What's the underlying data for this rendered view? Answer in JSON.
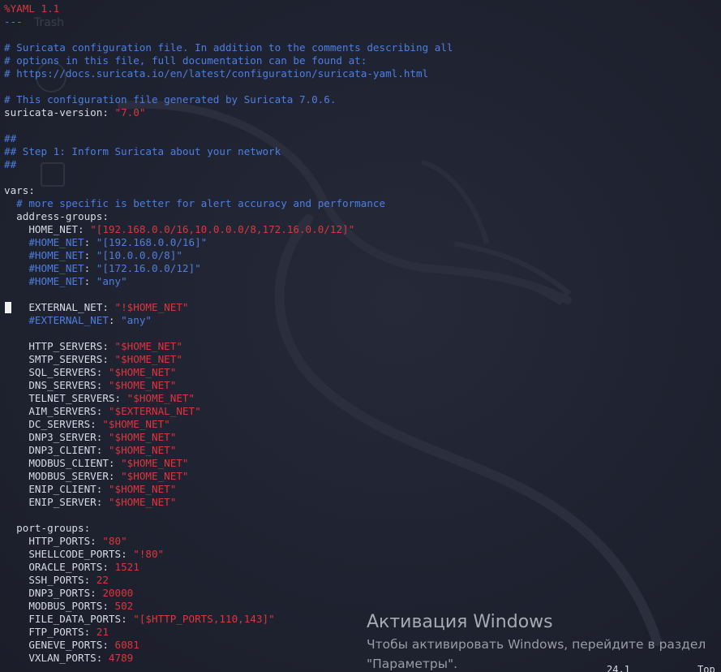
{
  "desktop": {
    "trash_label": "Trash"
  },
  "editor": {
    "lines": [
      [
        [
          "dir",
          "%YAML 1.1"
        ]
      ],
      [
        [
          "sep",
          "---"
        ]
      ],
      [],
      [
        [
          "c",
          "# Suricata configuration file. In addition to the comments describing all"
        ]
      ],
      [
        [
          "c",
          "# options in this file, full documentation can be found at:"
        ]
      ],
      [
        [
          "c",
          "# https://docs.suricata.io/en/latest/configuration/suricata-yaml.html"
        ]
      ],
      [],
      [
        [
          "c",
          "# This configuration file generated by Suricata 7.0.6."
        ]
      ],
      [
        [
          "k",
          "suricata-version"
        ],
        [
          "p",
          ": "
        ],
        [
          "s",
          "\"7.0\""
        ]
      ],
      [],
      [
        [
          "c",
          "##"
        ]
      ],
      [
        [
          "c",
          "## Step 1: Inform Suricata about your network"
        ]
      ],
      [
        [
          "c",
          "##"
        ]
      ],
      [],
      [
        [
          "k",
          "vars"
        ],
        [
          "p",
          ":"
        ]
      ],
      [
        [
          "p",
          "  "
        ],
        [
          "c",
          "# more specific is better for alert accuracy and performance"
        ]
      ],
      [
        [
          "p",
          "  "
        ],
        [
          "k",
          "address-groups"
        ],
        [
          "p",
          ":"
        ]
      ],
      [
        [
          "p",
          "    "
        ],
        [
          "k",
          "HOME_NET"
        ],
        [
          "p",
          ": "
        ],
        [
          "s",
          "\"[192.168.0.0/16,10.0.0.0/8,172.16.0.0/12]\""
        ]
      ],
      [
        [
          "p",
          "    "
        ],
        [
          "c",
          "#HOME_NET"
        ],
        [
          "p",
          ": "
        ],
        [
          "c",
          "\"[192.168.0.0/16]\""
        ]
      ],
      [
        [
          "p",
          "    "
        ],
        [
          "c",
          "#HOME_NET"
        ],
        [
          "p",
          ": "
        ],
        [
          "c",
          "\"[10.0.0.0/8]\""
        ]
      ],
      [
        [
          "p",
          "    "
        ],
        [
          "c",
          "#HOME_NET"
        ],
        [
          "p",
          ": "
        ],
        [
          "c",
          "\"[172.16.0.0/12]\""
        ]
      ],
      [
        [
          "p",
          "    "
        ],
        [
          "c",
          "#HOME_NET"
        ],
        [
          "p",
          ": "
        ],
        [
          "c",
          "\"any\""
        ]
      ],
      [],
      [
        [
          "p",
          "    "
        ],
        [
          "k",
          "EXTERNAL_NET"
        ],
        [
          "p",
          ": "
        ],
        [
          "s",
          "\"!$HOME_NET\""
        ]
      ],
      [
        [
          "p",
          "    "
        ],
        [
          "c",
          "#EXTERNAL_NET"
        ],
        [
          "p",
          ": "
        ],
        [
          "c",
          "\"any\""
        ]
      ],
      [],
      [
        [
          "p",
          "    "
        ],
        [
          "k",
          "HTTP_SERVERS"
        ],
        [
          "p",
          ": "
        ],
        [
          "s",
          "\"$HOME_NET\""
        ]
      ],
      [
        [
          "p",
          "    "
        ],
        [
          "k",
          "SMTP_SERVERS"
        ],
        [
          "p",
          ": "
        ],
        [
          "s",
          "\"$HOME_NET\""
        ]
      ],
      [
        [
          "p",
          "    "
        ],
        [
          "k",
          "SQL_SERVERS"
        ],
        [
          "p",
          ": "
        ],
        [
          "s",
          "\"$HOME_NET\""
        ]
      ],
      [
        [
          "p",
          "    "
        ],
        [
          "k",
          "DNS_SERVERS"
        ],
        [
          "p",
          ": "
        ],
        [
          "s",
          "\"$HOME_NET\""
        ]
      ],
      [
        [
          "p",
          "    "
        ],
        [
          "k",
          "TELNET_SERVERS"
        ],
        [
          "p",
          ": "
        ],
        [
          "s",
          "\"$HOME_NET\""
        ]
      ],
      [
        [
          "p",
          "    "
        ],
        [
          "k",
          "AIM_SERVERS"
        ],
        [
          "p",
          ": "
        ],
        [
          "s",
          "\"$EXTERNAL_NET\""
        ]
      ],
      [
        [
          "p",
          "    "
        ],
        [
          "k",
          "DC_SERVERS"
        ],
        [
          "p",
          ": "
        ],
        [
          "s",
          "\"$HOME_NET\""
        ]
      ],
      [
        [
          "p",
          "    "
        ],
        [
          "k",
          "DNP3_SERVER"
        ],
        [
          "p",
          ": "
        ],
        [
          "s",
          "\"$HOME_NET\""
        ]
      ],
      [
        [
          "p",
          "    "
        ],
        [
          "k",
          "DNP3_CLIENT"
        ],
        [
          "p",
          ": "
        ],
        [
          "s",
          "\"$HOME_NET\""
        ]
      ],
      [
        [
          "p",
          "    "
        ],
        [
          "k",
          "MODBUS_CLIENT"
        ],
        [
          "p",
          ": "
        ],
        [
          "s",
          "\"$HOME_NET\""
        ]
      ],
      [
        [
          "p",
          "    "
        ],
        [
          "k",
          "MODBUS_SERVER"
        ],
        [
          "p",
          ": "
        ],
        [
          "s",
          "\"$HOME_NET\""
        ]
      ],
      [
        [
          "p",
          "    "
        ],
        [
          "k",
          "ENIP_CLIENT"
        ],
        [
          "p",
          ": "
        ],
        [
          "s",
          "\"$HOME_NET\""
        ]
      ],
      [
        [
          "p",
          "    "
        ],
        [
          "k",
          "ENIP_SERVER"
        ],
        [
          "p",
          ": "
        ],
        [
          "s",
          "\"$HOME_NET\""
        ]
      ],
      [],
      [
        [
          "p",
          "  "
        ],
        [
          "k",
          "port-groups"
        ],
        [
          "p",
          ":"
        ]
      ],
      [
        [
          "p",
          "    "
        ],
        [
          "k",
          "HTTP_PORTS"
        ],
        [
          "p",
          ": "
        ],
        [
          "s",
          "\"80\""
        ]
      ],
      [
        [
          "p",
          "    "
        ],
        [
          "k",
          "SHELLCODE_PORTS"
        ],
        [
          "p",
          ": "
        ],
        [
          "s",
          "\"!80\""
        ]
      ],
      [
        [
          "p",
          "    "
        ],
        [
          "k",
          "ORACLE_PORTS"
        ],
        [
          "p",
          ": "
        ],
        [
          "n",
          "1521"
        ]
      ],
      [
        [
          "p",
          "    "
        ],
        [
          "k",
          "SSH_PORTS"
        ],
        [
          "p",
          ": "
        ],
        [
          "n",
          "22"
        ]
      ],
      [
        [
          "p",
          "    "
        ],
        [
          "k",
          "DNP3_PORTS"
        ],
        [
          "p",
          ": "
        ],
        [
          "n",
          "20000"
        ]
      ],
      [
        [
          "p",
          "    "
        ],
        [
          "k",
          "MODBUS_PORTS"
        ],
        [
          "p",
          ": "
        ],
        [
          "n",
          "502"
        ]
      ],
      [
        [
          "p",
          "    "
        ],
        [
          "k",
          "FILE_DATA_PORTS"
        ],
        [
          "p",
          ": "
        ],
        [
          "s",
          "\"[$HTTP_PORTS,110,143]\""
        ]
      ],
      [
        [
          "p",
          "    "
        ],
        [
          "k",
          "FTP_PORTS"
        ],
        [
          "p",
          ": "
        ],
        [
          "n",
          "21"
        ]
      ],
      [
        [
          "p",
          "    "
        ],
        [
          "k",
          "GENEVE_PORTS"
        ],
        [
          "p",
          ": "
        ],
        [
          "n",
          "6081"
        ]
      ],
      [
        [
          "p",
          "    "
        ],
        [
          "k",
          "VXLAN_PORTS"
        ],
        [
          "p",
          ": "
        ],
        [
          "n",
          "4789"
        ]
      ]
    ]
  },
  "statusbar": {
    "position": "24,1",
    "scroll": "Top"
  },
  "activation": {
    "title": "Активация Windows",
    "line1": "Чтобы активировать Windows, перейдите в раздел",
    "line2": "\"Параметры\"."
  }
}
